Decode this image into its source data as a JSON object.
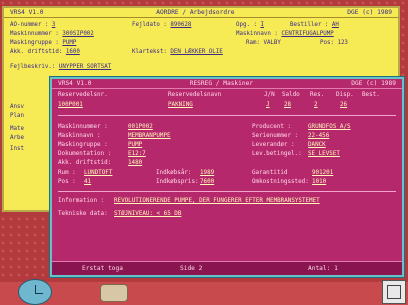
{
  "back_window": {
    "title_left": "VRS4 V1.0",
    "title_center": "AORDRE / Arbejdsordre",
    "title_right": "DGE (c) 1989",
    "rows": [
      {
        "l1": "AO-nummer   :",
        "v1": "3",
        "l2": "Fejldato :",
        "v2": "890628",
        "l3": "Opg. :",
        "v3": "I",
        "l4": "Bestiller :",
        "v4": "AH"
      },
      {
        "l1": "Maskinnummer :",
        "v1": "300SIP002",
        "l2": "",
        "v2": "",
        "l3": "Maskinnavn :",
        "v3": "CENTRIFUGALPUMP",
        "l4": "",
        "v4": ""
      },
      {
        "l1": "Maskingruppe :",
        "v1": "PUMP",
        "l2": "",
        "v2": "",
        "l3": "Ram: VALBY",
        "v3": "",
        "l4": "Pos: 123",
        "v4": ""
      },
      {
        "l1": "Akk. driftstid:",
        "v1": "1600",
        "l2": "Klartekst:",
        "v2": "DEN LÆKKER OLIE",
        "l3": "",
        "v3": "",
        "l4": "",
        "v4": ""
      }
    ],
    "fejlbeskriv_label": "Fejlbeskriv.:",
    "fejlbeskriv_value": "UNYPPER SORTSAT",
    "side_labels": [
      "Ansv",
      "Plan",
      "Mate",
      "Arbe",
      "Inst"
    ]
  },
  "front_window": {
    "title_left": "VRS4 V1.0",
    "title_center": "RESREG / Maskiner",
    "title_right": "DGE (c) 1989",
    "header": {
      "reservedelsnr_label": "Reservedelsnr.",
      "reservedelsnavn_label": "Reservedelsnavn",
      "jn_label": "J/N",
      "saldo_label": "Saldo",
      "res_label": "Res.",
      "disp_label": "Disp.",
      "best_label": "Best.",
      "reservedelsnr": "100P001",
      "reservedelsnavn": "PAKNING",
      "jn": "J",
      "saldo": "28",
      "res": "2",
      "disp": "26"
    },
    "fields_left": [
      {
        "label": "Maskinnummer :",
        "value": "001P002"
      },
      {
        "label": "Maskinnavn   :",
        "value": "MEMBRANPUMPE"
      },
      {
        "label": "Maskingruppe :",
        "value": "PUMP"
      },
      {
        "label": "Dokumentation :",
        "value": "E12:7"
      },
      {
        "label": "Akk. driftstid:",
        "value": "1480"
      }
    ],
    "fields_right": [
      {
        "label": "Producent    :",
        "value": "GRUNDFOS A/S"
      },
      {
        "label": "Serienummer  :",
        "value": "22-456"
      },
      {
        "label": "Leverandør   :",
        "value": "DANCK"
      },
      {
        "label": "Lev.betingel.:",
        "value": "SE LEVSET"
      }
    ],
    "rum_label": "Rum :",
    "rum": "LUNDTOFT",
    "indkobsar_label": "Indkøbsår:",
    "indkobsar": "1989",
    "garantitid_label": "Garantitid",
    "garantitid": "901201",
    "pos_label": "Pos :",
    "pos": "41",
    "indkobspris_label": "Indkøbspris:",
    "indkobspris": "7600",
    "omkost_label": "Omkostningssted:",
    "omkost": "1010",
    "information_label": "Information :",
    "information": "REVOLUTIONERENDE PUMPE, DER FUNGERER EFTER MEMBRANSYSTEMET",
    "tekniske_label": "Tekniske data:",
    "tekniske": "STØJNIVEAU: < 65 DB",
    "status": {
      "left": "Erstat toga",
      "center": "Side 2",
      "right": "Antal: 1"
    }
  },
  "desktop": {
    "icons": [
      "clock-icon",
      "dish-icon",
      "cube-icon"
    ]
  }
}
